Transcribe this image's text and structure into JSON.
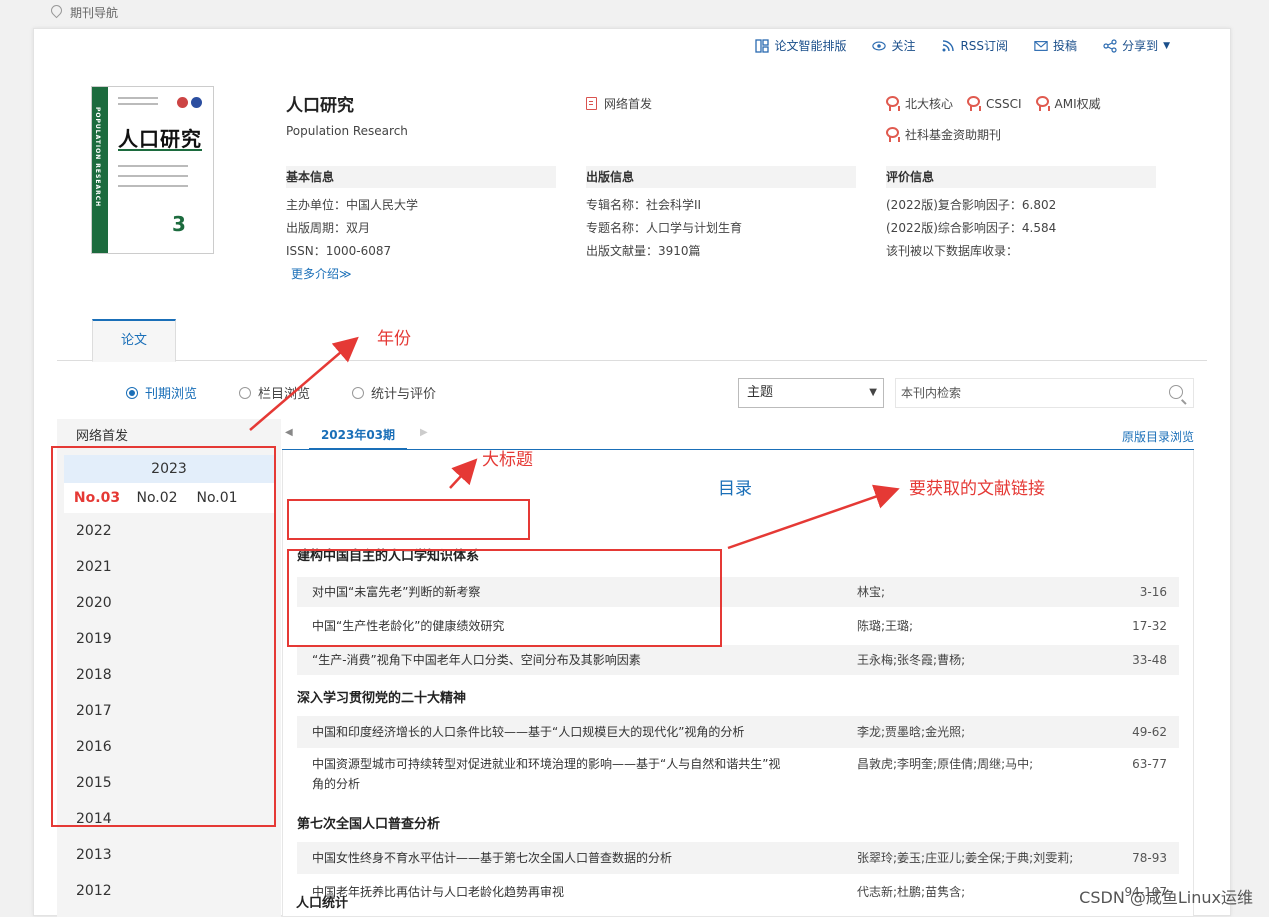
{
  "breadcrumb": "期刊导航",
  "toolbar": {
    "items": [
      {
        "label": "论文智能排版",
        "icon": "layout-icon"
      },
      {
        "label": "关注",
        "icon": "eye-icon"
      },
      {
        "label": "RSS订阅",
        "icon": "rss-icon"
      },
      {
        "label": "投稿",
        "icon": "mail-icon"
      },
      {
        "label": "分享到",
        "icon": "share-icon"
      }
    ]
  },
  "journal": {
    "title": "人口研究",
    "subtitle": "Population Research",
    "first_publish": "网络首发",
    "cover": {
      "title": "人口研究",
      "spine": "POPULATION RESEARCH",
      "number": "3"
    },
    "badges": [
      "北大核心",
      "CSSCI",
      "AMI权威",
      "社科基金资助期刊"
    ],
    "basic": {
      "head": "基本信息",
      "rows": [
        "主办单位：中国人民大学",
        "出版周期：双月",
        "ISSN：1000-6087"
      ],
      "more": "更多介绍≫"
    },
    "publish": {
      "head": "出版信息",
      "rows": [
        "专辑名称：社会科学II",
        "专题名称：人口学与计划生育",
        "出版文献量：3910篇"
      ]
    },
    "eval": {
      "head": "评价信息",
      "rows": [
        "(2022版)复合影响因子：6.802",
        "(2022版)综合影响因子：4.584",
        "该刊被以下数据库收录："
      ]
    }
  },
  "tabs": {
    "paper": "论文"
  },
  "browse": {
    "options": [
      "刊期浏览",
      "栏目浏览",
      "统计与评价"
    ],
    "selected": 0
  },
  "search": {
    "select_value": "主题",
    "placeholder": "本刊内检索"
  },
  "sidebar": {
    "net_first": "网络首发",
    "current_year": "2023",
    "issues": [
      "No.03",
      "No.02",
      "No.01"
    ],
    "years": [
      "2022",
      "2021",
      "2020",
      "2019",
      "2018",
      "2017",
      "2016",
      "2015",
      "2014",
      "2013",
      "2012"
    ]
  },
  "issue_tab": "2023年03期",
  "orig_toc": "原版目录浏览",
  "toc": {
    "sections": [
      {
        "title": "建构中国自主的人口学知识体系",
        "articles": [
          {
            "title": "对中国“未富先老”判断的新考察",
            "authors": "林宝;",
            "pages": "3-16"
          },
          {
            "title": "中国“生产性老龄化”的健康绩效研究",
            "authors": "陈璐;王璐;",
            "pages": "17-32"
          },
          {
            "title": "“生产-消费”视角下中国老年人口分类、空间分布及其影响因素",
            "authors": "王永梅;张冬霞;曹杨;",
            "pages": "33-48"
          }
        ]
      },
      {
        "title": "深入学习贯彻党的二十大精神",
        "articles": [
          {
            "title": "中国和印度经济增长的人口条件比较——基于“人口规模巨大的现代化”视角的分析",
            "authors": "李龙;贾墨晗;金光照;",
            "pages": "49-62"
          },
          {
            "title": "中国资源型城市可持续转型对促进就业和环境治理的影响——基于“人与自然和谐共生”视角的分析",
            "authors": "昌敦虎;李明奎;原佳倩;周继;马中;",
            "pages": "63-77"
          }
        ]
      },
      {
        "title": "第七次全国人口普查分析",
        "articles": [
          {
            "title": "中国女性终身不育水平估计——基于第七次全国人口普查数据的分析",
            "authors": "张翠玲;姜玉;庄亚儿;姜全保;于典;刘雯莉;",
            "pages": "78-93"
          },
          {
            "title": "中国老年抚养比再估计与人口老龄化趋势再审视",
            "authors": "代志新;杜鹏;苗隽含;",
            "pages": "94-107"
          }
        ]
      },
      {
        "title": "人口统计",
        "articles": []
      }
    ]
  },
  "annotations": {
    "year": "年份",
    "big_title": "大标题",
    "toc_label": "目录",
    "links": "要获取的文献链接"
  },
  "watermark": "CSDN @咸鱼Linux运维",
  "colors": {
    "accent": "#1a6fb8",
    "annotation": "#e53935",
    "active_issue": "#e53935"
  }
}
